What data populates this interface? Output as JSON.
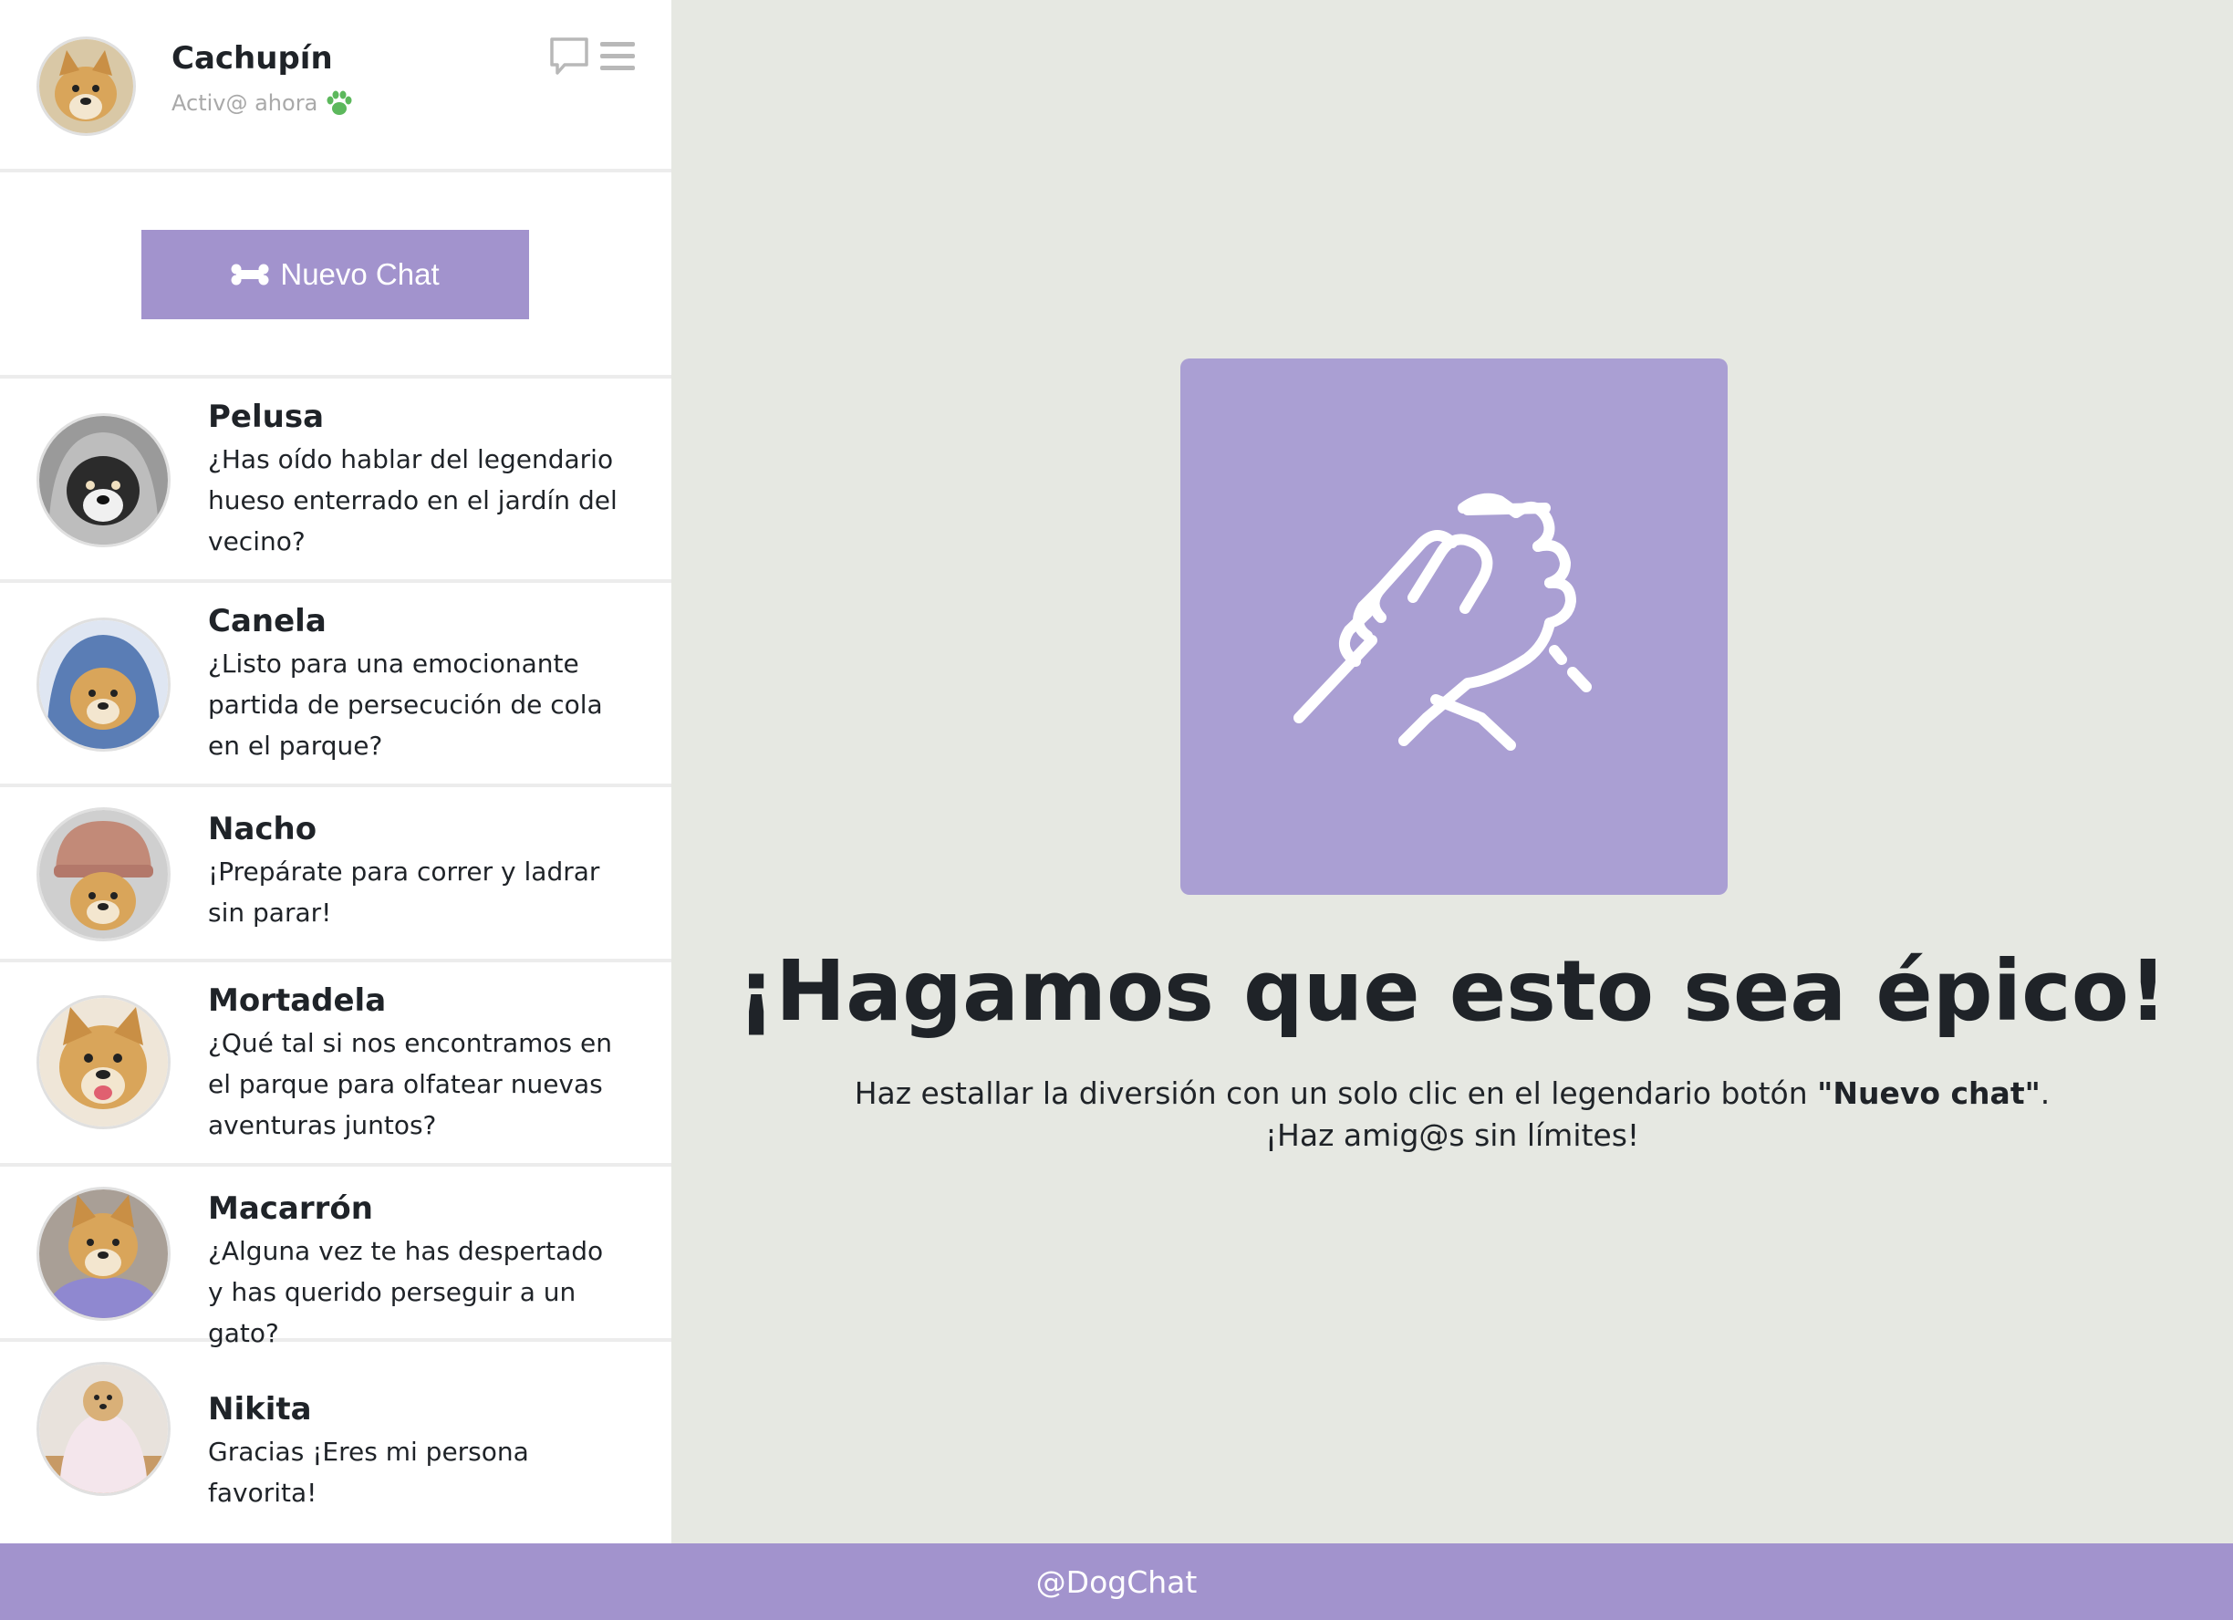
{
  "profile": {
    "name": "Cachupín",
    "status": "Activ@ ahora",
    "avatar_icon": "dog-avatar-icon"
  },
  "header_icons": [
    "chat-bubble-icon",
    "menu-icon"
  ],
  "new_chat": {
    "label": "Nuevo Chat",
    "icon": "bone-icon"
  },
  "chats": [
    {
      "name": "Pelusa",
      "message": "¿Has oído hablar del legendario hueso enterrado en el jardín del vecino?"
    },
    {
      "name": "Canela",
      "message": "¿Listo para una emocionante partida de persecución de cola en el parque?"
    },
    {
      "name": "Nacho",
      "message": "¡Prepárate para correr y ladrar sin parar!"
    },
    {
      "name": "Mortadela",
      "message": "¿Qué tal si nos encontramos en el parque para olfatear nuevas aventuras juntos?"
    },
    {
      "name": "Macarrón",
      "message": "¿Alguna vez te has despertado y has querido perseguir a un gato?"
    },
    {
      "name": "Nikita",
      "message": "Gracias ¡Eres mi persona favorita!"
    }
  ],
  "main": {
    "icon": "handshake-icon",
    "title": "¡Hagamos que esto sea épico!",
    "subtitle_pre": "Haz estallar la diversión con un solo clic en el legendario botón ",
    "subtitle_bold": "\"Nuevo chat\"",
    "subtitle_post": ".",
    "subtitle_line2": "¡Haz amig@s sin límites!"
  },
  "footer": {
    "text": "@DogChat"
  },
  "colors": {
    "accent": "#a293cd",
    "hero_box": "#aa9fd3",
    "main_bg": "#e6e8e2",
    "status_paw": "#5cb85c"
  }
}
